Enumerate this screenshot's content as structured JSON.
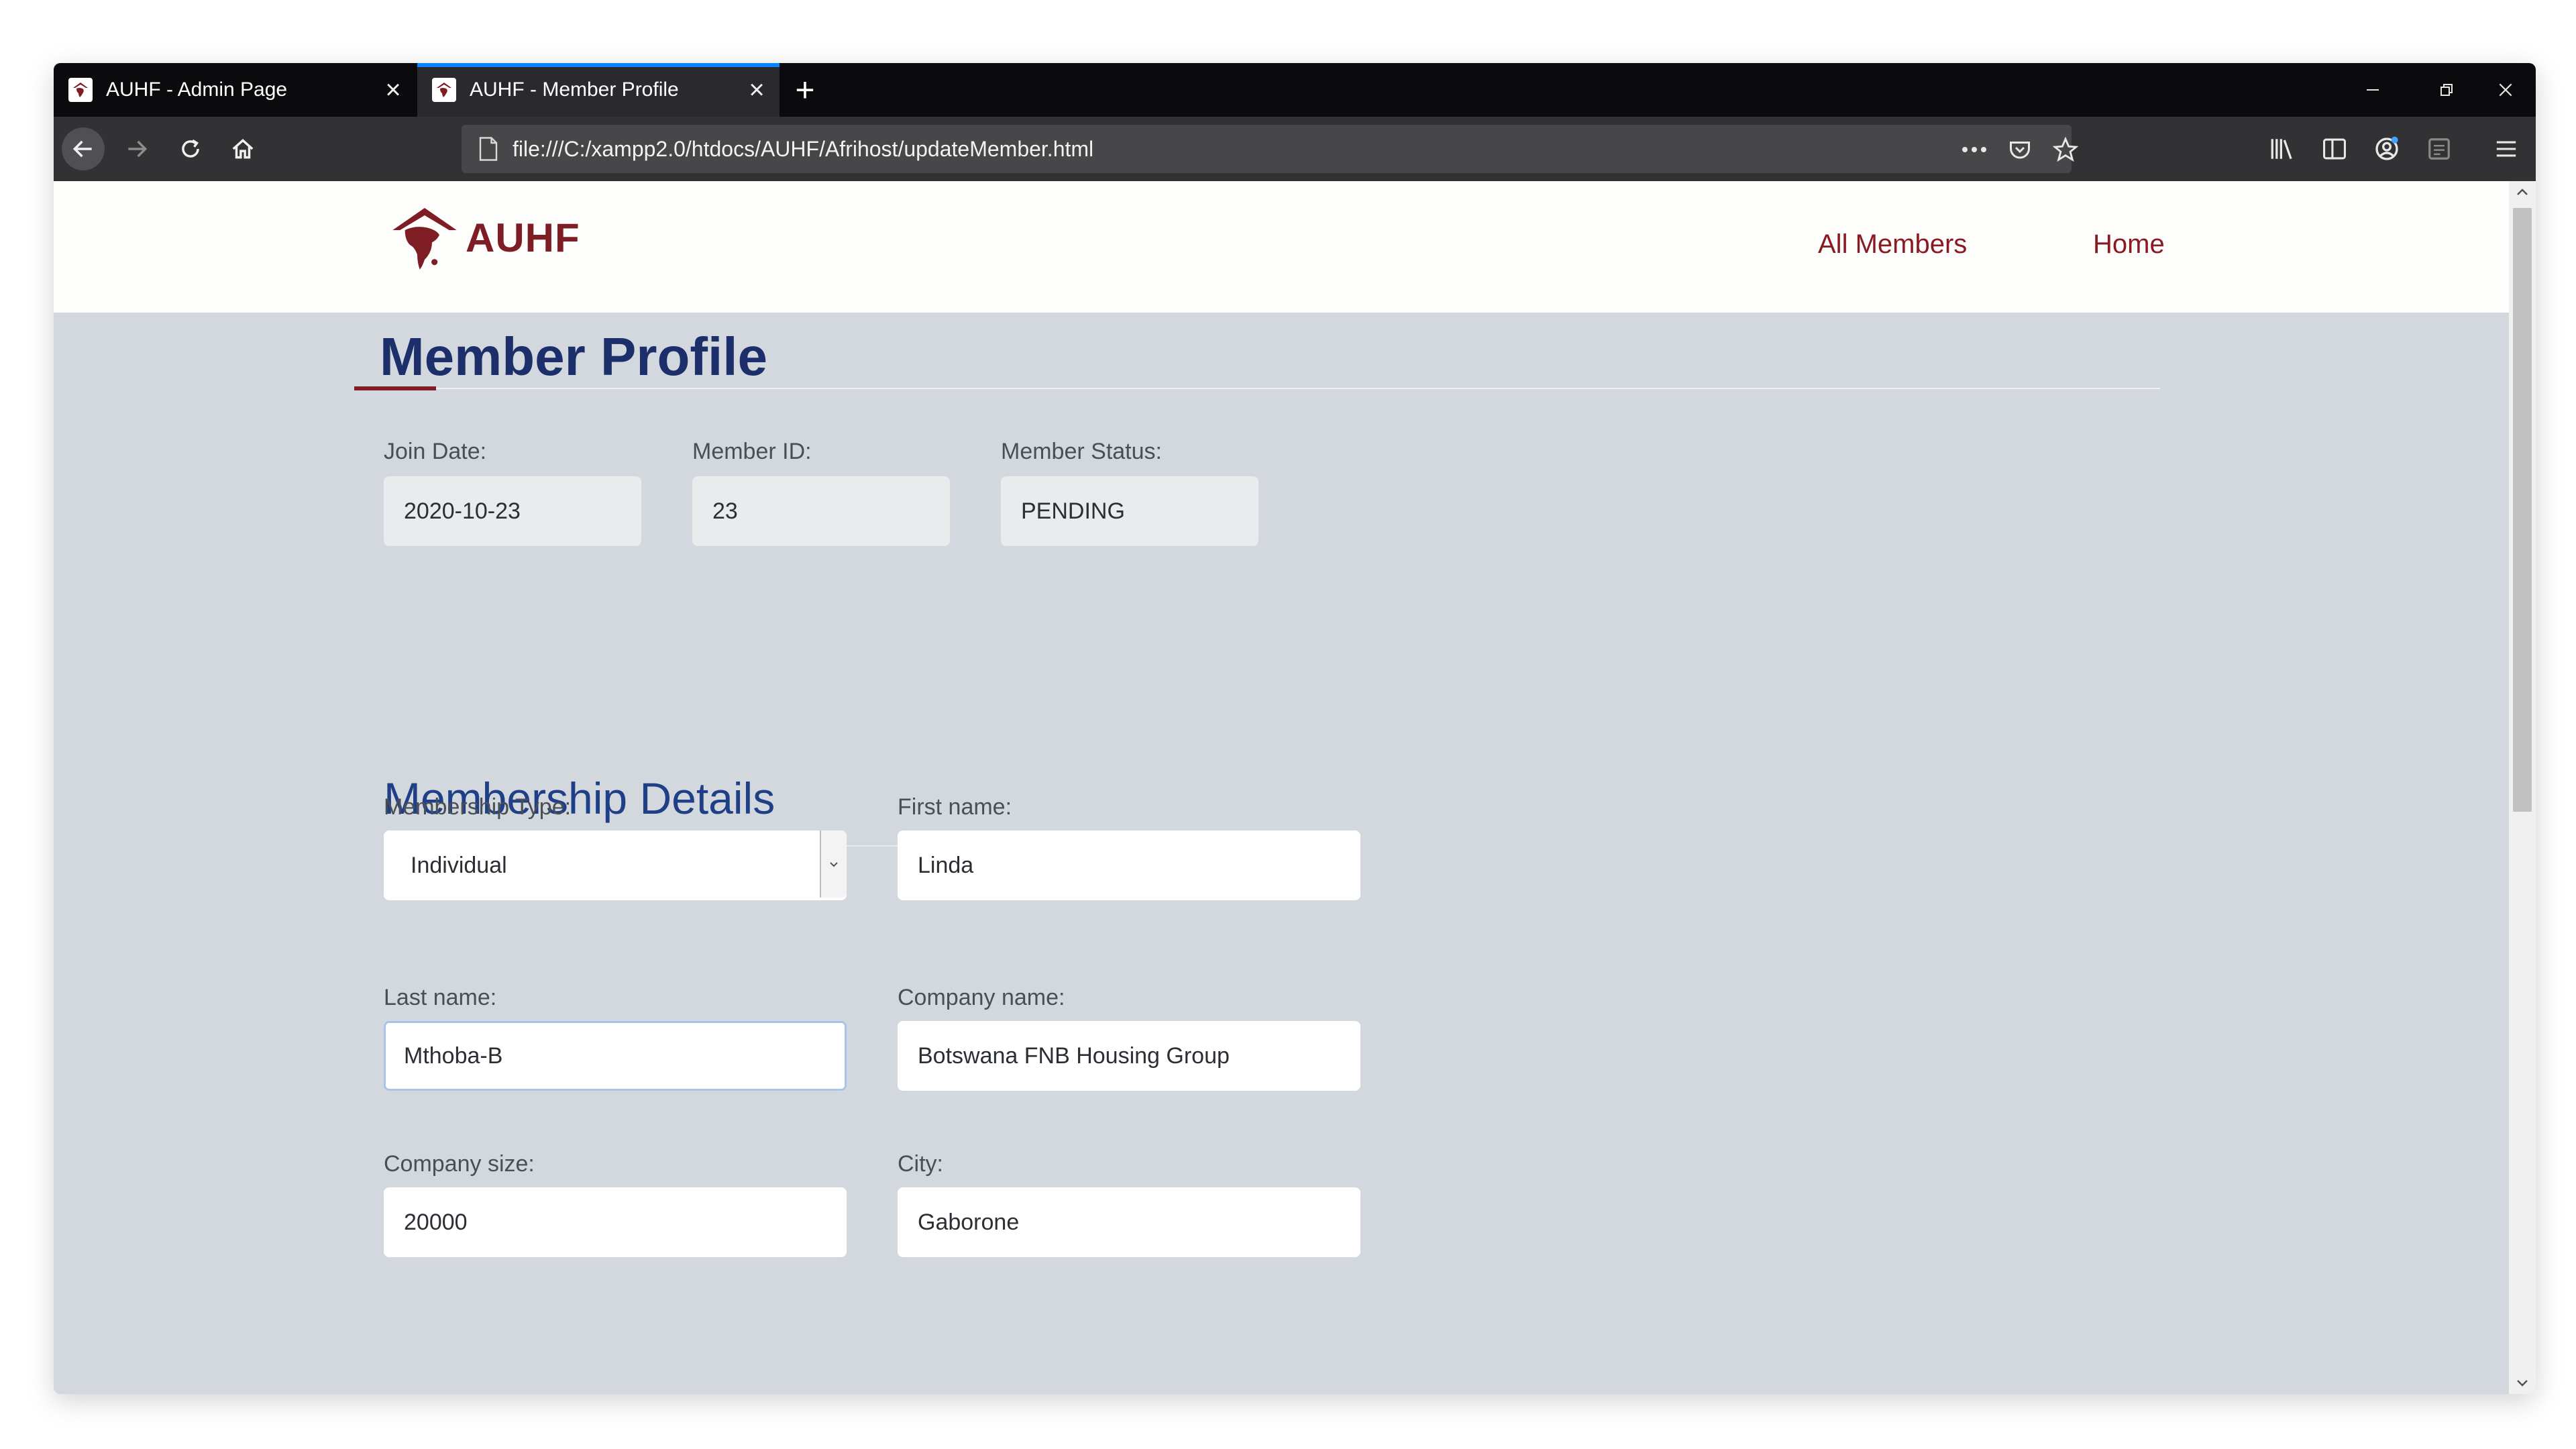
{
  "browser": {
    "tabs": [
      {
        "title": "AUHF - Admin Page",
        "active": false
      },
      {
        "title": "AUHF - Member Profile",
        "active": true
      }
    ],
    "url": "file:///C:/xampp2.0/htdocs/AUHF/Afrihost/updateMember.html",
    "accent_color": "#0a84ff"
  },
  "site": {
    "logo_text": "AUHF",
    "brand_color": "#7f1d24",
    "nav": [
      {
        "label": "All Members"
      },
      {
        "label": "Home"
      }
    ]
  },
  "page": {
    "title": "Member Profile",
    "title_color": "#1c2f6b"
  },
  "summary": {
    "join_date": {
      "label": "Join Date:",
      "value": "2020-10-23"
    },
    "member_id": {
      "label": "Member ID:",
      "value": "23"
    },
    "member_status": {
      "label": "Member Status:",
      "value": "PENDING"
    }
  },
  "membership": {
    "heading": "Membership Details",
    "membership_type": {
      "label": "Membership Type:",
      "value": "Individual"
    },
    "first_name": {
      "label": "First name:",
      "value": "Linda"
    },
    "last_name": {
      "label": "Last name:",
      "value": "Mthoba-B"
    },
    "company_name": {
      "label": "Company name:",
      "value": "Botswana FNB Housing Group"
    },
    "company_size": {
      "label": "Company size:",
      "value": "20000"
    },
    "city": {
      "label": "City:",
      "value": "Gaborone"
    }
  }
}
